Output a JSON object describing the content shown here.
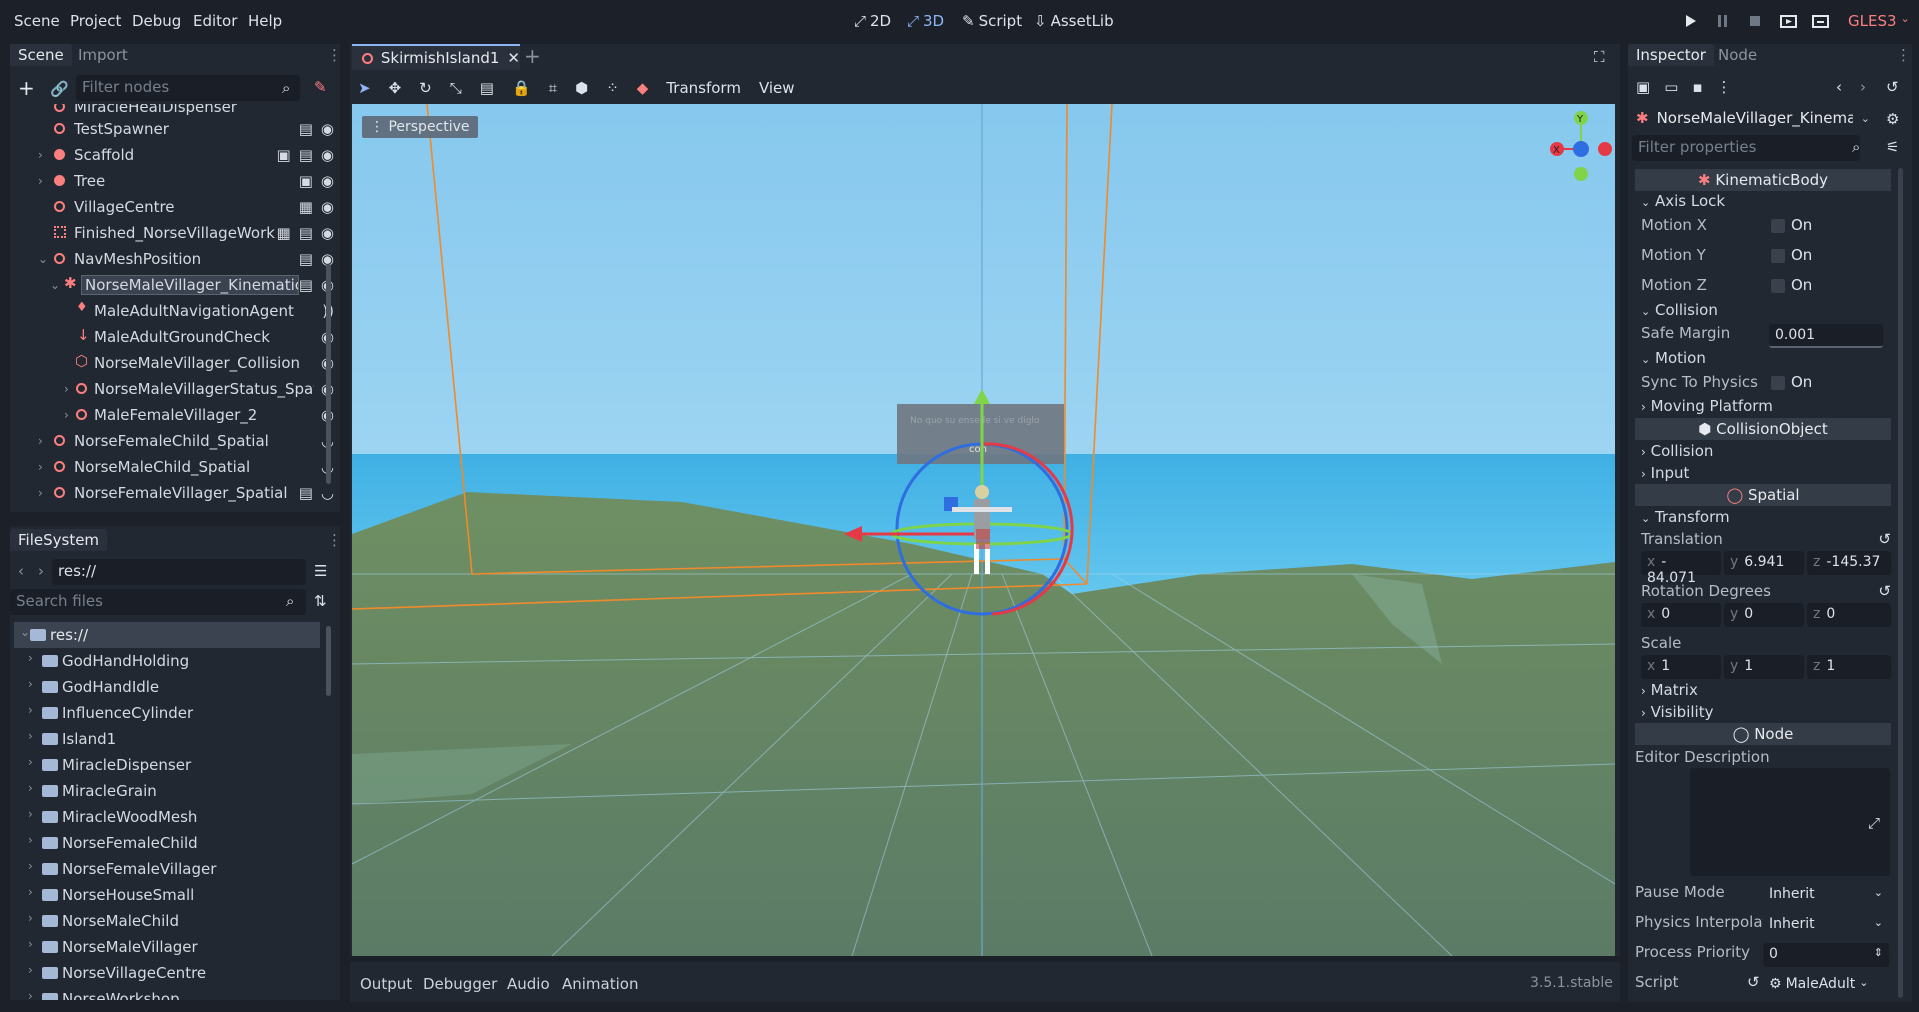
{
  "menu": [
    "Scene",
    "Project",
    "Debug",
    "Editor",
    "Help"
  ],
  "modes": {
    "m2d": "2D",
    "m3d": "3D",
    "script": "Script",
    "assetlib": "AssetLib"
  },
  "renderer": "GLES3",
  "scene_dock": {
    "tabs": [
      "Scene",
      "Import"
    ],
    "filter_placeholder": "Filter nodes",
    "rows": [
      "MiracleHealDispenser",
      "TestSpawner",
      "Scaffold",
      "Tree",
      "VillageCentre",
      "Finished_NorseVillageWork",
      "NavMeshPosition",
      "NorseMaleVillager_Kinematic",
      "MaleAdultNavigationAgent",
      "MaleAdultGroundCheck",
      "NorseMaleVillager_Collision",
      "NorseMaleVillagerStatus_Spati",
      "MaleFemaleVillager_2",
      "NorseFemaleChild_Spatial",
      "NorseMaleChild_Spatial",
      "NorseFemaleVillager_Spatial"
    ]
  },
  "filesystem": {
    "title": "FileSystem",
    "path": "res://",
    "search_placeholder": "Search files",
    "root": "res://",
    "folders": [
      "GodHandHolding",
      "GodHandIdle",
      "InfluenceCylinder",
      "Island1",
      "MiracleDispenser",
      "MiracleGrain",
      "MiracleWoodMesh",
      "NorseFemaleChild",
      "NorseFemaleVillager",
      "NorseHouseSmall",
      "NorseMaleChild",
      "NorseMaleVillager",
      "NorseVillageCentre",
      "NorseWorkshop"
    ]
  },
  "editor": {
    "tab": "SkirmishIsland1",
    "toolbar": {
      "transform": "Transform",
      "view": "View"
    },
    "perspective": "Perspective",
    "gizmo": {
      "x": "X",
      "y": "Y"
    },
    "village_sign": {
      "line1": "No quo su ensede si ve diglo",
      "line2": "con"
    }
  },
  "bottom_panel": {
    "tabs": [
      "Output",
      "Debugger",
      "Audio",
      "Animation"
    ],
    "version": "3.5.1.stable"
  },
  "inspector": {
    "tabs": [
      "Inspector",
      "Node"
    ],
    "object": "NorseMaleVillager_Kinemati",
    "filter_placeholder": "Filter properties",
    "kinematic_body": "KinematicBody",
    "axis_lock": "Axis Lock",
    "motion_x": "Motion X",
    "motion_y": "Motion Y",
    "motion_z": "Motion Z",
    "on": "On",
    "collision": "Collision",
    "safe_margin": "Safe Margin",
    "safe_margin_value": "0.001",
    "motion": "Motion",
    "sync_to_physics": "Sync To Physics",
    "moving_platform": "Moving Platform",
    "collision_object": "CollisionObject",
    "input": "Input",
    "spatial": "Spatial",
    "transform": "Transform",
    "translation": "Translation",
    "translation_values": {
      "x": "-84.071",
      "y": "6.941",
      "z": "-145.37"
    },
    "rotation_degrees": "Rotation Degrees",
    "rotation_values": {
      "x": "0",
      "y": "0",
      "z": "0"
    },
    "scale": "Scale",
    "scale_values": {
      "x": "1",
      "y": "1",
      "z": "1"
    },
    "axis": {
      "x": "x",
      "y": "y",
      "z": "z"
    },
    "matrix": "Matrix",
    "visibility": "Visibility",
    "node": "Node",
    "editor_description": "Editor Description",
    "pause_mode": "Pause Mode",
    "pause_mode_value": "Inherit",
    "physics_interp": "Physics Interpolati",
    "physics_interp_value": "Inherit",
    "process_priority": "Process Priority",
    "process_priority_value": "0",
    "script": "Script",
    "script_value": "MaleAdult"
  },
  "colors": {
    "accent": "#8fb7f5",
    "node_red": "#fc7f7f",
    "background": "#1b2029",
    "panel": "#222831"
  }
}
